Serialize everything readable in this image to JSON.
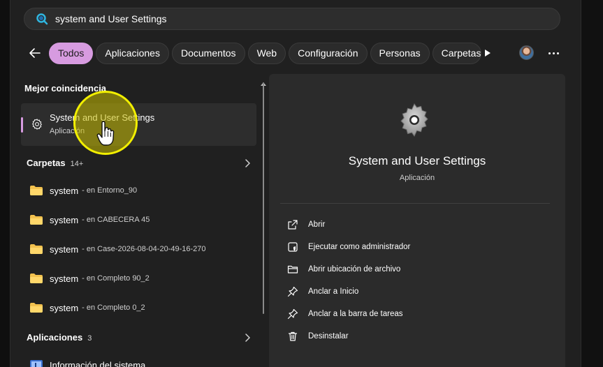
{
  "search": {
    "query": "system and User Settings"
  },
  "filters": {
    "back_icon": "arrow-left-icon",
    "chips": [
      "Todos",
      "Aplicaciones",
      "Documentos",
      "Web",
      "Configuración",
      "Personas",
      "Carpetas"
    ],
    "active_index": 0,
    "accent_color": "#d79be0"
  },
  "results": {
    "best_match_title": "Mejor coincidencia",
    "best_match": {
      "title": "System and User Settings",
      "subtitle": "Aplicación",
      "icon": "gear-icon"
    },
    "folders_group": {
      "name": "Carpetas",
      "count": "14+"
    },
    "folders": [
      {
        "name": "system",
        "location": "- en Entorno_90"
      },
      {
        "name": "system",
        "location": "- en CABECERA 45"
      },
      {
        "name": "system",
        "location": "- en Case-2026-08-04-20-49-16-270"
      },
      {
        "name": "system",
        "location": "- en Completo 90_2"
      },
      {
        "name": "system",
        "location": "- en Completo 0_2"
      }
    ],
    "apps_group": {
      "name": "Aplicaciones",
      "count": "3"
    },
    "apps": [
      {
        "name": "Información del sistema",
        "icon": "system-info-icon"
      }
    ]
  },
  "detail": {
    "name": "System and User Settings",
    "kind": "Aplicación",
    "actions": [
      {
        "label": "Abrir",
        "icon": "open-external-icon"
      },
      {
        "label": "Ejecutar como administrador",
        "icon": "shield-admin-icon"
      },
      {
        "label": "Abrir ubicación de archivo",
        "icon": "folder-open-icon"
      },
      {
        "label": "Anclar a Inicio",
        "icon": "pin-icon"
      },
      {
        "label": "Anclar a la barra de tareas",
        "icon": "pin-taskbar-icon"
      },
      {
        "label": "Desinstalar",
        "icon": "trash-icon"
      }
    ]
  }
}
